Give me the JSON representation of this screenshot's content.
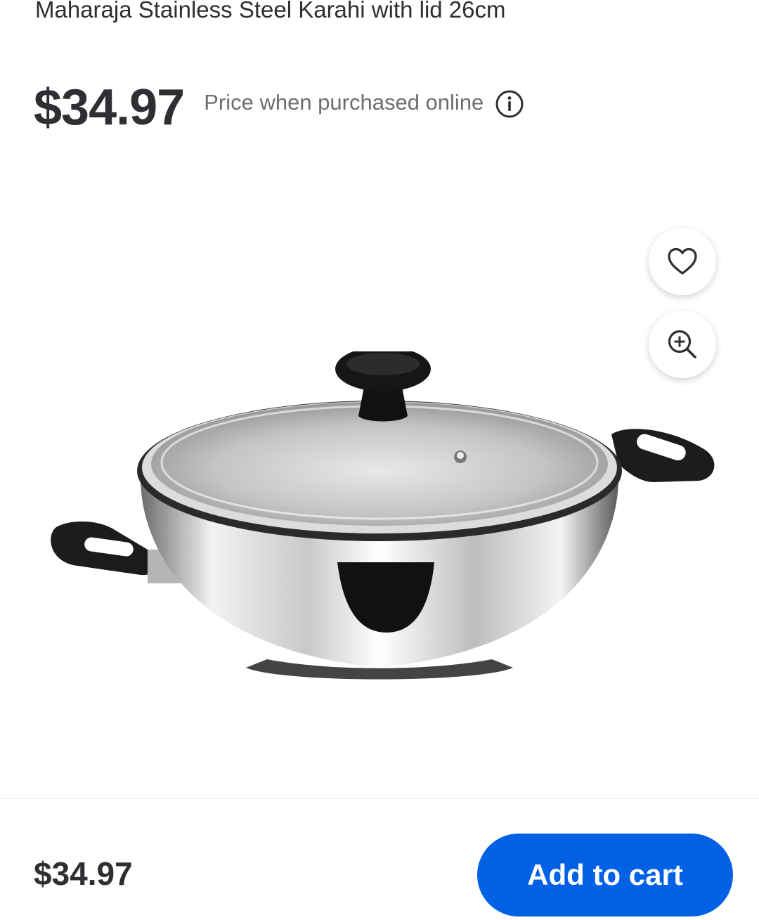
{
  "product": {
    "title": "Maharaja Stainless Steel Karahi with lid 26cm",
    "price": "$34.97",
    "price_note": "Price when purchased online"
  },
  "icons": {
    "info": "info-icon",
    "favorite": "heart-icon",
    "zoom": "zoom-in-icon"
  },
  "footer": {
    "price": "$34.97",
    "cart_label": "Add to cart"
  },
  "colors": {
    "accent": "#0061e4",
    "text": "#2e2f32",
    "muted": "#6d6e71"
  }
}
